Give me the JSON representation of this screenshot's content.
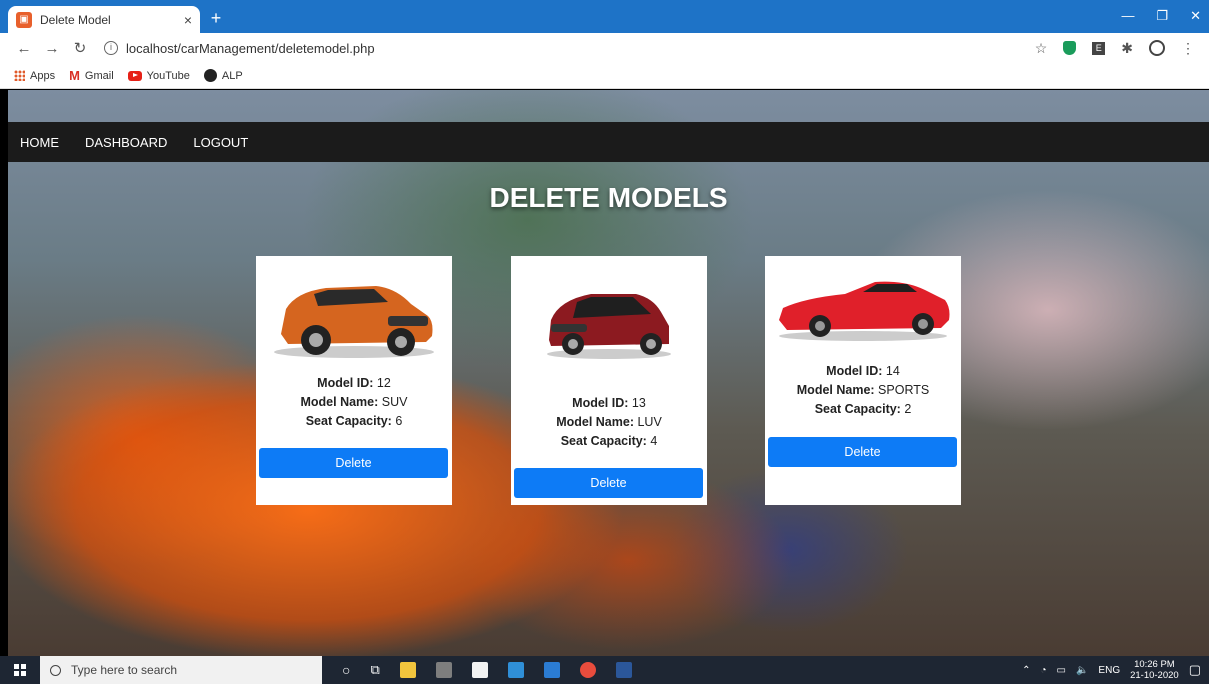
{
  "browser": {
    "tab_title": "Delete Model",
    "tab_close": "×",
    "new_tab": "+",
    "url": "localhost/carManagement/deletemodel.php",
    "bookmarks": [
      "Apps",
      "Gmail",
      "YouTube",
      "ALP"
    ]
  },
  "nav": {
    "links": [
      "HOME",
      "DASHBOARD",
      "LOGOUT"
    ]
  },
  "page": {
    "title": "DELETE MODELS"
  },
  "models": [
    {
      "id_label": "Model ID:",
      "id": "12",
      "name_label": "Model Name:",
      "name": "SUV",
      "seat_label": "Seat Capacity:",
      "seats": "6",
      "button": "Delete",
      "car_color": "#d5651f"
    },
    {
      "id_label": "Model ID:",
      "id": "13",
      "name_label": "Model Name:",
      "name": "LUV",
      "seat_label": "Seat Capacity:",
      "seats": "4",
      "button": "Delete",
      "car_color": "#8c1a20"
    },
    {
      "id_label": "Model ID:",
      "id": "14",
      "name_label": "Model Name:",
      "name": "SPORTS",
      "seat_label": "Seat Capacity:",
      "seats": "2",
      "button": "Delete",
      "car_color": "#e0202a"
    }
  ],
  "taskbar": {
    "search_placeholder": "Type here to search",
    "lang": "ENG",
    "time": "10:26 PM",
    "date": "21-10-2020"
  },
  "colors": {
    "accent": "#0d7bf6",
    "navbar": "#1b1b1b",
    "tabstrip": "#1e73c7"
  }
}
